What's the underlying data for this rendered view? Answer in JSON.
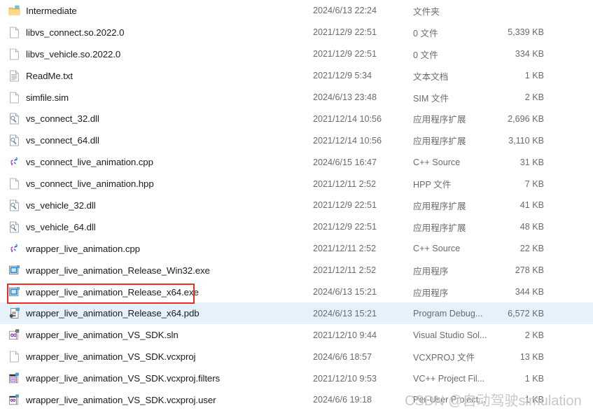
{
  "window": {
    "view": "details-list",
    "accent_selection_color": "#e5f1fb",
    "annotation_color": "#ef2b24"
  },
  "watermark": {
    "text": "CSDN @自动驾驶simulation"
  },
  "annotation": {
    "target_row_index": 13,
    "label": "wrapper_live_animation_Release_x64.exe"
  },
  "files": [
    {
      "name": "Intermediate",
      "date": "2024/6/13 22:24",
      "type": "文件夹",
      "size": "",
      "icon": "folder-icon",
      "selected": false
    },
    {
      "name": "libvs_connect.so.2022.0",
      "date": "2021/12/9 22:51",
      "type": "0 文件",
      "size": "5,339 KB",
      "icon": "blank-file-icon",
      "selected": false
    },
    {
      "name": "libvs_vehicle.so.2022.0",
      "date": "2021/12/9 22:51",
      "type": "0 文件",
      "size": "334 KB",
      "icon": "blank-file-icon",
      "selected": false
    },
    {
      "name": "ReadMe.txt",
      "date": "2021/12/9 5:34",
      "type": "文本文档",
      "size": "1 KB",
      "icon": "text-file-icon",
      "selected": false
    },
    {
      "name": "simfile.sim",
      "date": "2024/6/13 23:48",
      "type": "SIM 文件",
      "size": "2 KB",
      "icon": "blank-file-icon",
      "selected": false
    },
    {
      "name": "vs_connect_32.dll",
      "date": "2021/12/14 10:56",
      "type": "应用程序扩展",
      "size": "2,696 KB",
      "icon": "dll-file-icon",
      "selected": false
    },
    {
      "name": "vs_connect_64.dll",
      "date": "2021/12/14 10:56",
      "type": "应用程序扩展",
      "size": "3,110 KB",
      "icon": "dll-file-icon",
      "selected": false
    },
    {
      "name": "vs_connect_live_animation.cpp",
      "date": "2024/6/15 16:47",
      "type": "C++ Source",
      "size": "31 KB",
      "icon": "cpp-source-icon",
      "selected": false
    },
    {
      "name": "vs_connect_live_animation.hpp",
      "date": "2021/12/11 2:52",
      "type": "HPP 文件",
      "size": "7 KB",
      "icon": "blank-file-icon",
      "selected": false
    },
    {
      "name": "vs_vehicle_32.dll",
      "date": "2021/12/9 22:51",
      "type": "应用程序扩展",
      "size": "41 KB",
      "icon": "dll-file-icon",
      "selected": false
    },
    {
      "name": "vs_vehicle_64.dll",
      "date": "2021/12/9 22:51",
      "type": "应用程序扩展",
      "size": "48 KB",
      "icon": "dll-file-icon",
      "selected": false
    },
    {
      "name": "wrapper_live_animation.cpp",
      "date": "2021/12/11 2:52",
      "type": "C++ Source",
      "size": "22 KB",
      "icon": "cpp-source-icon",
      "selected": false
    },
    {
      "name": "wrapper_live_animation_Release_Win32.exe",
      "date": "2021/12/11 2:52",
      "type": "应用程序",
      "size": "278 KB",
      "icon": "exe-file-icon",
      "selected": false
    },
    {
      "name": "wrapper_live_animation_Release_x64.exe",
      "date": "2024/6/13 15:21",
      "type": "应用程序",
      "size": "344 KB",
      "icon": "exe-file-icon",
      "selected": false
    },
    {
      "name": "wrapper_live_animation_Release_x64.pdb",
      "date": "2024/6/13 15:21",
      "type": "Program Debug...",
      "size": "6,572 KB",
      "icon": "pdb-file-icon",
      "selected": true
    },
    {
      "name": "wrapper_live_animation_VS_SDK.sln",
      "date": "2021/12/10 9:44",
      "type": "Visual Studio Sol...",
      "size": "2 KB",
      "icon": "sln-file-icon",
      "selected": false
    },
    {
      "name": "wrapper_live_animation_VS_SDK.vcxproj",
      "date": "2024/6/6 18:57",
      "type": "VCXPROJ 文件",
      "size": "13 KB",
      "icon": "blank-file-icon",
      "selected": false
    },
    {
      "name": "wrapper_live_animation_VS_SDK.vcxproj.filters",
      "date": "2021/12/10 9:53",
      "type": "VC++ Project Fil...",
      "size": "1 KB",
      "icon": "filters-file-icon",
      "selected": false
    },
    {
      "name": "wrapper_live_animation_VS_SDK.vcxproj.user",
      "date": "2024/6/6 19:18",
      "type": "Per-User Project...",
      "size": "1 KB",
      "icon": "vcxproj-user-icon",
      "selected": false
    }
  ]
}
